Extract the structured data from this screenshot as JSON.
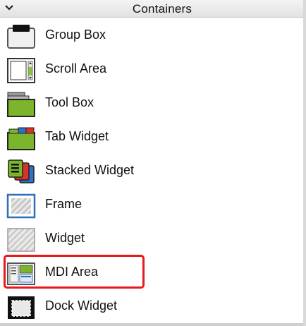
{
  "panel": {
    "title": "Containers",
    "collapse_icon": "chevron-down-icon"
  },
  "items": [
    {
      "label": "Group Box",
      "icon": "group-box-icon"
    },
    {
      "label": "Scroll Area",
      "icon": "scroll-area-icon"
    },
    {
      "label": "Tool Box",
      "icon": "tool-box-icon"
    },
    {
      "label": "Tab Widget",
      "icon": "tab-widget-icon"
    },
    {
      "label": "Stacked Widget",
      "icon": "stacked-widget-icon"
    },
    {
      "label": "Frame",
      "icon": "frame-icon"
    },
    {
      "label": "Widget",
      "icon": "widget-icon"
    },
    {
      "label": "MDI Area",
      "icon": "mdi-area-icon"
    },
    {
      "label": "Dock Widget",
      "icon": "dock-widget-icon"
    }
  ],
  "highlighted_item": "MDI Area",
  "highlight_color": "#e8191d"
}
